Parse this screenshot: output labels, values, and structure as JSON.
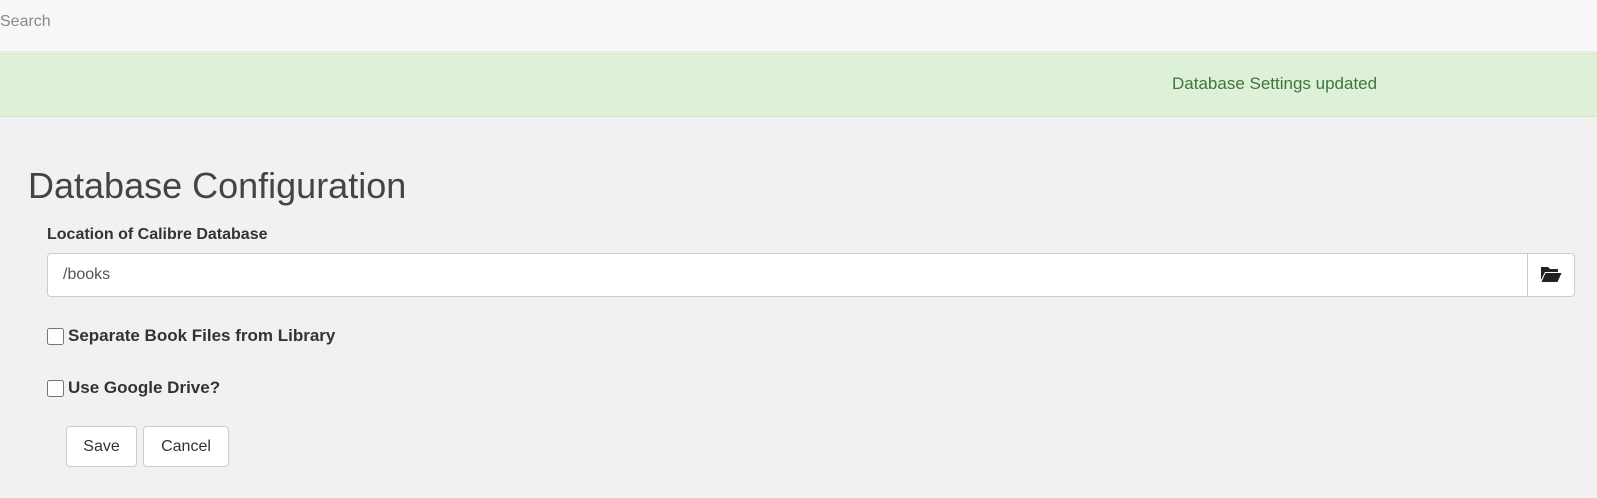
{
  "header": {
    "search_placeholder": "Search"
  },
  "alert": {
    "message": "Database Settings updated",
    "color": "#3c763d",
    "background": "#dff0d8"
  },
  "page": {
    "title": "Database Configuration"
  },
  "form": {
    "location_label": "Location of Calibre Database",
    "location_value": "/books",
    "browse_icon": "folder-open-icon",
    "separate_files_label": "Separate Book Files from Library",
    "separate_files_checked": false,
    "google_drive_label": "Use Google Drive?",
    "google_drive_checked": false
  },
  "actions": {
    "save_label": "Save",
    "cancel_label": "Cancel"
  }
}
